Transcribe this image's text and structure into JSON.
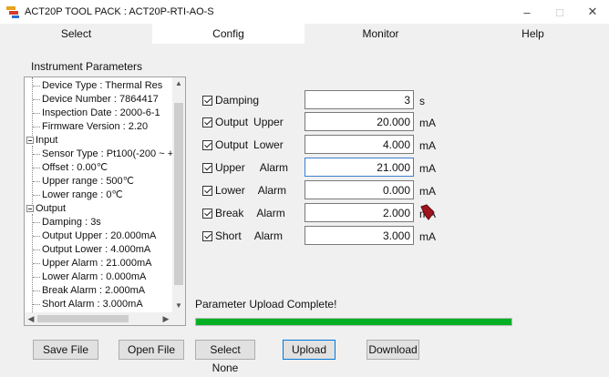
{
  "window": {
    "title": "ACT20P TOOL PACK : ACT20P-RTI-AO-S",
    "minimize": "–",
    "maximize": "□",
    "close": "✕"
  },
  "tabs": [
    {
      "label": "Select",
      "active": false
    },
    {
      "label": "Config",
      "active": true
    },
    {
      "label": "Monitor",
      "active": false
    },
    {
      "label": "Help",
      "active": false
    }
  ],
  "instrument_parameters": {
    "label": "Instrument Parameters",
    "tree": {
      "device_items": [
        "Device Type : Thermal Res",
        "Device Number : 7864417",
        "Inspection Date : 2000-6-1",
        "Firmware Version : 2.20"
      ],
      "input_group": "Input",
      "input_items": [
        "Sensor Type : Pt100(-200 ~ +",
        "Offset : 0.00℃",
        "Upper range : 500℃",
        "Lower range : 0℃"
      ],
      "output_group": "Output",
      "output_items": [
        "Damping : 3s",
        "Output   Upper : 20.000mA",
        "Output   Lower : 4.000mA",
        "Upper     Alarm : 21.000mA",
        "Lower     Alarm : 0.000mA",
        "Break     Alarm : 2.000mA",
        "Short     Alarm : 3.000mA"
      ]
    }
  },
  "params": {
    "damping": {
      "label": "Damping",
      "sub": "",
      "value": "3",
      "unit": "s"
    },
    "output_upper": {
      "label": "Output",
      "sub": "Upper",
      "value": "20.000",
      "unit": "mA"
    },
    "output_lower": {
      "label": "Output",
      "sub": "Lower",
      "value": "4.000",
      "unit": "mA"
    },
    "upper_alarm": {
      "label": "Upper",
      "sub": "Alarm",
      "value": "21.000",
      "unit": "mA"
    },
    "lower_alarm": {
      "label": "Lower",
      "sub": "Alarm",
      "value": "0.000",
      "unit": "mA"
    },
    "break_alarm": {
      "label": "Break",
      "sub": "Alarm",
      "value": "2.000",
      "unit": "mA"
    },
    "short_alarm": {
      "label": "Short",
      "sub": "Alarm",
      "value": "3.000",
      "unit": "mA"
    }
  },
  "status": {
    "message": "Parameter Upload Complete!",
    "progress": 1.0,
    "progress_color": "#06b025"
  },
  "buttons": {
    "save_file": "Save File",
    "open_file": "Open File",
    "select_none": "Select None",
    "upload": "Upload",
    "download": "Download"
  },
  "colors": {
    "focus_blue": "#0078d7",
    "cursor_red": "#a0141e"
  }
}
